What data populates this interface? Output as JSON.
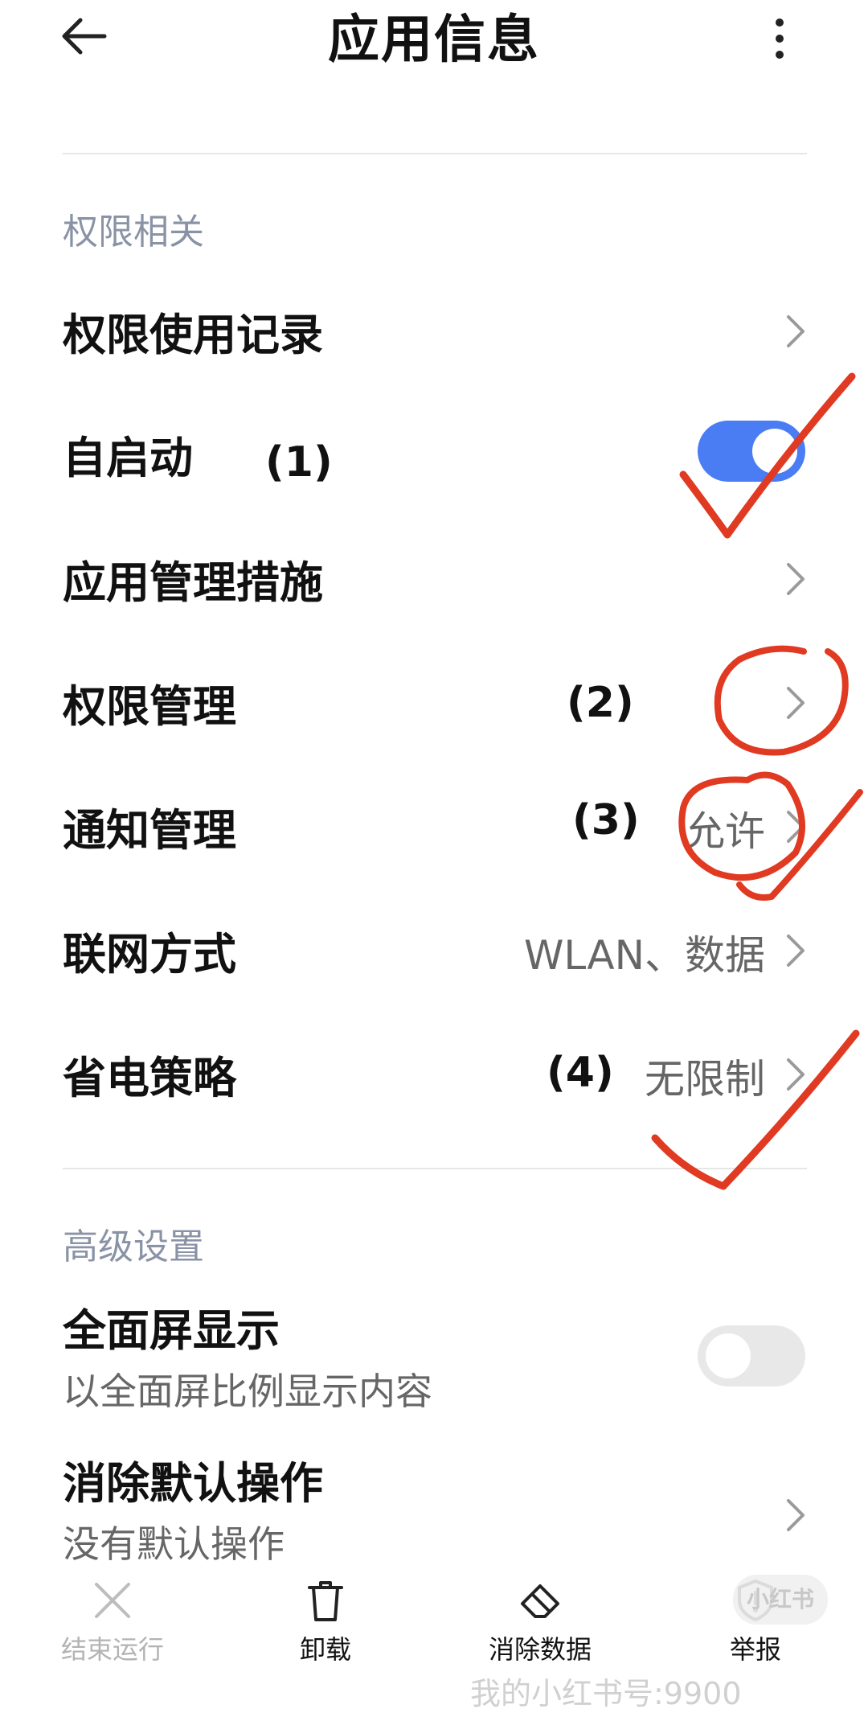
{
  "header": {
    "title": "应用信息",
    "back_icon": "back-arrow-icon",
    "more_icon": "more-vertical-icon"
  },
  "permissions_section": {
    "title": "权限相关",
    "items": [
      {
        "label": "权限使用记录",
        "value": "",
        "type": "link"
      },
      {
        "label": "自启动",
        "value": "",
        "type": "toggle",
        "enabled": true,
        "annotation": "(1)"
      },
      {
        "label": "应用管理措施",
        "value": "",
        "type": "link"
      },
      {
        "label": "权限管理",
        "value": "",
        "type": "link",
        "annotation": "(2)"
      },
      {
        "label": "通知管理",
        "value": "允许",
        "type": "link",
        "annotation": "(3)"
      },
      {
        "label": "联网方式",
        "value": "WLAN、数据",
        "type": "link"
      },
      {
        "label": "省电策略",
        "value": "无限制",
        "type": "link",
        "annotation": "(4)"
      }
    ]
  },
  "advanced_section": {
    "title": "高级设置",
    "items": [
      {
        "label": "全面屏显示",
        "subtitle": "以全面屏比例显示内容",
        "type": "toggle",
        "enabled": false
      },
      {
        "label": "消除默认操作",
        "subtitle": "没有默认操作",
        "type": "link"
      }
    ]
  },
  "bottom_bar": [
    {
      "label": "结束运行",
      "icon": "close-icon",
      "disabled": true
    },
    {
      "label": "卸载",
      "icon": "trash-icon",
      "disabled": false
    },
    {
      "label": "消除数据",
      "icon": "eraser-icon",
      "disabled": false
    },
    {
      "label": "举报",
      "icon": "shield-alert-icon",
      "disabled": false
    }
  ],
  "watermark": {
    "text": "我的小红书号:9900",
    "logo": "小红书"
  },
  "colors": {
    "accent": "#4a7cf3",
    "toggle_off": "#e8e8e8",
    "section_title": "#8a93a6",
    "annotation_red": "#e03a22"
  }
}
